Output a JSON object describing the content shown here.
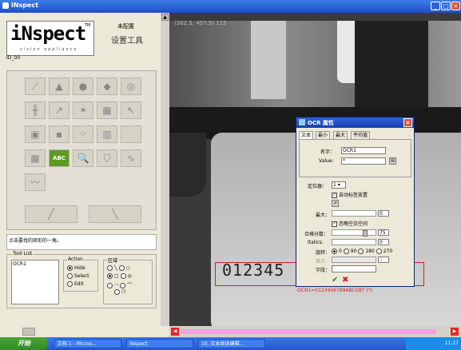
{
  "window": {
    "title": "iNspect",
    "minimize": "_",
    "maximize": "□",
    "close": "×"
  },
  "logo": {
    "text": "iNspect",
    "tm": "TM",
    "tagline": "vision appliance"
  },
  "header": {
    "unconfigured": "未配置",
    "setup_tools": "设置工具"
  },
  "job_id": "ID_00",
  "tool_palette": {
    "ocr_label": "ABC"
  },
  "hint": "点击要找的矩形的一角。",
  "toollist": {
    "title": "Tool List",
    "items": [
      "OCR1"
    ],
    "action_title": "Action",
    "actions": [
      "Hide",
      "Select",
      "Edit"
    ],
    "selected_action": "Hide",
    "region_title": "区域"
  },
  "image": {
    "coords": "(262.5, 457.5) 115",
    "digits": "012345",
    "ocr_result": "-OCR1=0123456789ABCDEF (*)"
  },
  "dialog": {
    "title": "OCR 属性",
    "tabs": [
      "文本",
      "最小",
      "最大",
      "平均值"
    ],
    "name_label": "名字：",
    "name_value": "OCR1",
    "value_label": "Value:",
    "value_value": "*",
    "digits_label": "定位器：",
    "digits_value": "1",
    "auto_label": "自动标签放置",
    "max_label": "最大：",
    "max_value": "0",
    "ignore_space_label": "忽略空白空间",
    "grade_label": "合格分数：",
    "grade_value": "75",
    "italics_label": "Italics:",
    "italics_value": "0",
    "rotate_label": "旋转：",
    "rotate_options": [
      "0",
      "90",
      "180",
      "270"
    ],
    "rotate_selected": "0",
    "display_label": "显示：",
    "display_value": "1",
    "font_label": "字段：",
    "ok": "✔",
    "cancel": "✖"
  },
  "taskbar": {
    "start": "开始",
    "tasks": [
      "文档 1 - Micros...",
      "iNspect",
      "10. 文本阅读编辑..."
    ],
    "clock": "11:27"
  },
  "colors": {
    "titlebar": "#1c4fc7",
    "ocr_button": "#5c9a24",
    "ocr_box": "#d02020"
  }
}
